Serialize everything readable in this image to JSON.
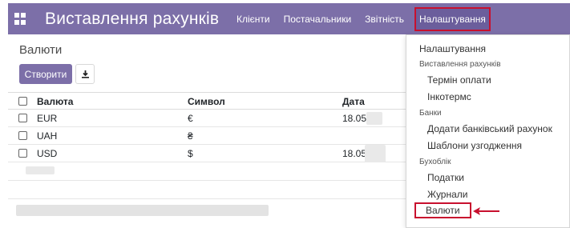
{
  "app": {
    "title": "Виставлення рахунків"
  },
  "menu": [
    {
      "label": "Клієнти"
    },
    {
      "label": "Постачальники"
    },
    {
      "label": "Звітність"
    },
    {
      "label": "Налаштування"
    }
  ],
  "page": {
    "title": "Валюти"
  },
  "toolbar": {
    "create_label": "Створити",
    "download_icon": "download-icon"
  },
  "table": {
    "columns": [
      "Валюта",
      "Символ",
      "Дата"
    ],
    "rows": [
      {
        "name": "EUR",
        "symbol": "€",
        "date": "18.05"
      },
      {
        "name": "UAH",
        "symbol": "₴",
        "date": ""
      },
      {
        "name": "USD",
        "symbol": "$",
        "date": "18.05"
      }
    ]
  },
  "dropdown": {
    "top_item": "Налаштування",
    "sections": [
      {
        "header": "Виставлення рахунків",
        "items": [
          "Термін оплати",
          "Інкотермс"
        ]
      },
      {
        "header": "Банки",
        "items": [
          "Додати банківський рахунок",
          "Шаблони узгодження"
        ]
      },
      {
        "header": "Бухоблік",
        "items": [
          "Податки",
          "Журнали",
          "Валюти"
        ]
      }
    ]
  },
  "colors": {
    "brand": "#7c6fa8",
    "highlight": "#c8102e"
  }
}
